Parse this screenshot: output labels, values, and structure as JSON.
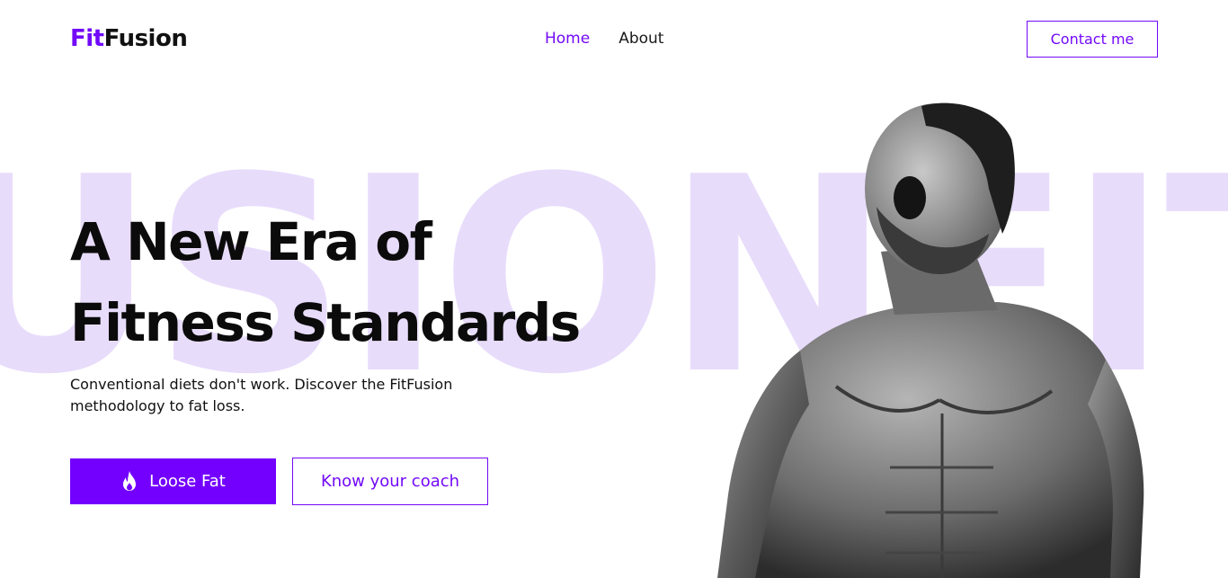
{
  "background_word": "USIONFITF",
  "header": {
    "logo_part1": "Fit",
    "logo_part2": "Fusion",
    "nav": [
      {
        "label": "Home",
        "active": true
      },
      {
        "label": "About",
        "active": false
      }
    ],
    "contact_label": "Contact me"
  },
  "hero": {
    "title_line1": "A New Era of",
    "title_line2": "Fitness Standards",
    "subtitle": "Conventional diets don't work. Discover the FitFusion methodology to fat loss.",
    "primary_button": "Loose Fat",
    "primary_icon": "flame-icon",
    "secondary_button": "Know your coach"
  },
  "colors": {
    "accent": "#7209f8",
    "primary_button_bg": "#7300ff",
    "watermark": "#e8dcfb"
  }
}
